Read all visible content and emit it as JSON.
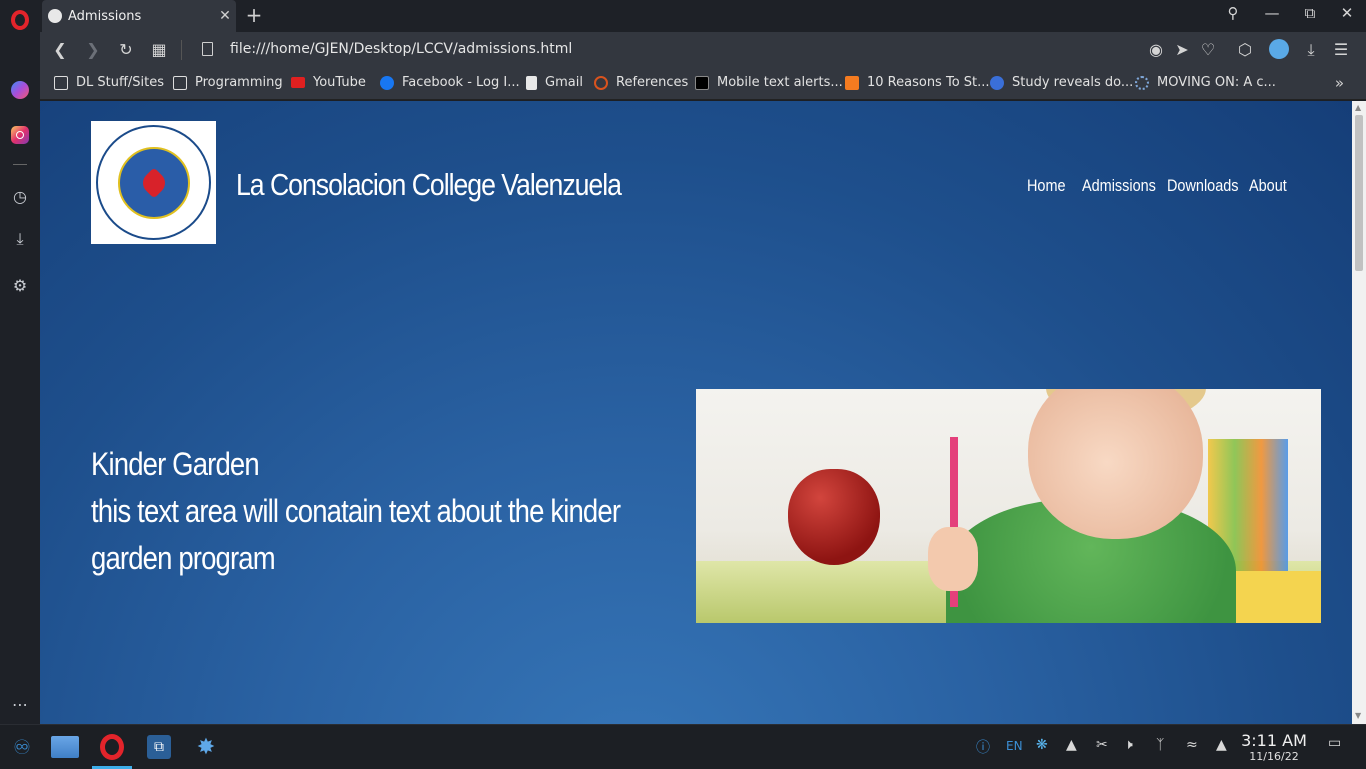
{
  "browser": {
    "tab_title": "Admissions",
    "url": "file:///home/GJEN/Desktop/LCCV/admissions.html"
  },
  "bookmarks": [
    {
      "label": "DL Stuff/Sites",
      "icon": "folder-icon"
    },
    {
      "label": "Programming",
      "icon": "folder-icon"
    },
    {
      "label": "YouTube",
      "icon": "youtube-icon"
    },
    {
      "label": "Facebook - Log I...",
      "icon": "facebook-icon"
    },
    {
      "label": "Gmail",
      "icon": "page-icon"
    },
    {
      "label": "References",
      "icon": "graduation-cap-icon"
    },
    {
      "label": "Mobile text alerts...",
      "icon": "w-icon"
    },
    {
      "label": "10 Reasons To St...",
      "icon": "checkbox-icon"
    },
    {
      "label": "Study reveals do...",
      "icon": "inq-icon"
    },
    {
      "label": "MOVING ON: A c...",
      "icon": "globe-icon"
    }
  ],
  "site": {
    "brand": "La Consolacion College Valenzuela",
    "logo_ring_text": "LA CONSOLACION COLLEGE VALENZUELA",
    "logo_motto": "UNITY CHARITY TRUTH",
    "logo_year": "1963",
    "logo_city": "Malinta, Valenzuela City",
    "nav": [
      {
        "label": "Home"
      },
      {
        "label": "Admissions"
      },
      {
        "label": "Downloads"
      },
      {
        "label": "About"
      }
    ],
    "section_title": "Kinder Garden",
    "section_body": "this text area will conatain text about the kinder garden program"
  },
  "taskbar": {
    "language": "EN",
    "time": "3:11 AM",
    "date": "11/16/22"
  },
  "colors": {
    "page_bg_top": "#153e78",
    "page_bg_bottom": "#3676b8",
    "opera_red": "#e3242b"
  }
}
